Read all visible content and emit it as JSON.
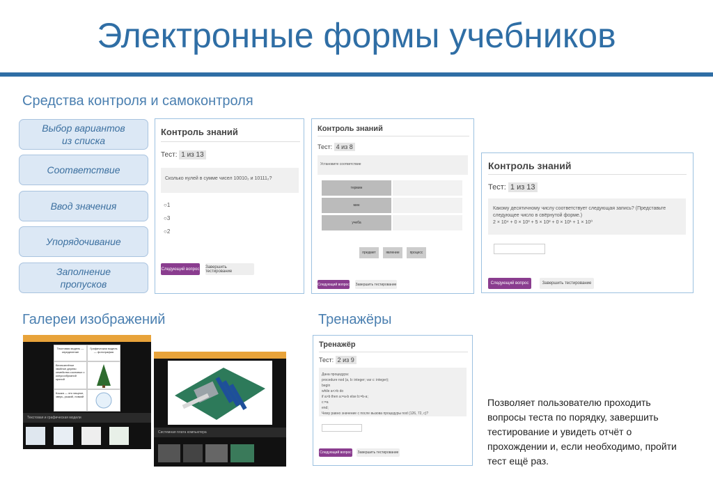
{
  "page": {
    "title": "Электронные формы учебников"
  },
  "sections": {
    "control": "Средства контроля и самоконтроля",
    "gallery": "Галереи изображений",
    "trainers": "Тренажёры"
  },
  "pills": [
    "Выбор вариантов\nиз списка",
    "Соответствие",
    "Ввод значения",
    "Упорядочивание",
    "Заполнение\nпропусков"
  ],
  "panel1": {
    "title": "Контроль знаний",
    "test_label": "Тест:",
    "test_progress": "1 из 13",
    "question": "Сколько нулей в сумме чисел 10010₂ и 10111₂?",
    "options": [
      "1",
      "3",
      "2"
    ],
    "next_btn": "Следующий вопрос",
    "finish_btn": "Завершить тестирование"
  },
  "panel2": {
    "title": "Контроль знаний",
    "test_label": "Тест:",
    "test_progress": "4 из 8",
    "question": "Установите соответствие",
    "rows": [
      "термин",
      "мин",
      "учеба"
    ],
    "chips": [
      "предмет",
      "явление",
      "процесс"
    ],
    "next_btn": "Следующий вопрос",
    "finish_btn": "Завершить тестирование"
  },
  "panel3": {
    "title": "Контроль знаний",
    "test_label": "Тест:",
    "test_progress": "1 из 13",
    "question": "Какому десятичному числу соответствует следующая запись? (Представьте следующее число в свёрнутой форме.)",
    "formula": "2 × 10⁴ + 0 × 10³ + 5 × 10² + 0 × 10¹ + 1 × 10⁰",
    "next_btn": "Следующий вопрос",
    "finish_btn": "Завершить тестирование"
  },
  "panel4": {
    "title": "Тренажёр",
    "test_label": "Тест:",
    "test_progress": "2 из 9",
    "code_lines": [
      "Дана процедура:",
      "procedure nod (a, b: integer; var c: integer);",
      "begin",
      "while a<>b do",
      "if a>b then a:=a-b else b:=b-a;",
      "c:=a",
      "end;",
      "Чему равно значение c после вызова процедуры nod (126, 72, c)?"
    ],
    "next_btn": "Следующий вопрос",
    "finish_btn": "Завершить тестирование"
  },
  "gallery1": {
    "col1_head": "Текстовая модель — определение",
    "col2_head": "Графическая модель — фотография",
    "cell1": "Вечнозелёное хвойное дерево семейства сосновых с конусообразной кроной",
    "cell2": "Кошка — это хищное, зверь, рыжий, ловкий",
    "caption": "Текстовая и графическая модели"
  },
  "gallery2": {
    "caption": "Системная плата компьютера"
  },
  "description": "Позволяет пользователю проходить вопросы теста по порядку, завершить тестирование и увидеть отчёт о прохождении и, если необходимо, пройти тест ещё раз.",
  "colors": {
    "accent": "#2f6ea5",
    "pill_bg": "#dce8f5",
    "button_primary": "#8a3d8f",
    "gallery_bar": "#e8a33a"
  }
}
